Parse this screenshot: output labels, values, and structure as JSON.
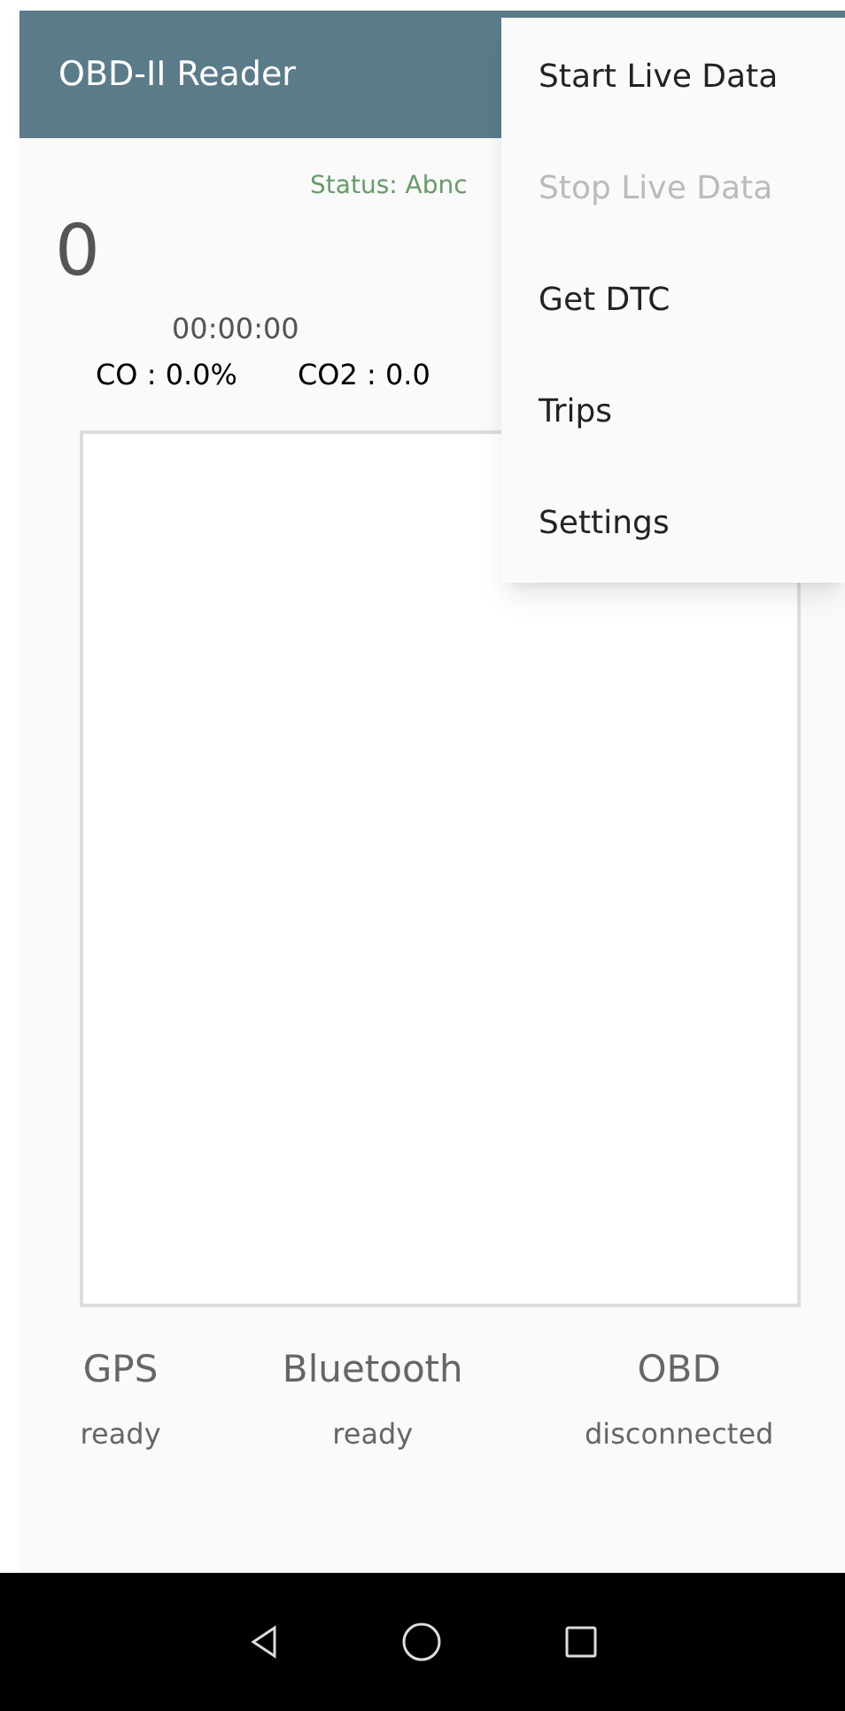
{
  "app_bar": {
    "title": "OBD-II Reader"
  },
  "status": "Status: Abnc",
  "speed": "0",
  "timer": "00:00:00",
  "readings": [
    "CO : 0.0%",
    "CO2 : 0.0"
  ],
  "indicators": [
    {
      "name": "GPS",
      "state": "ready"
    },
    {
      "name": "Bluetooth",
      "state": "ready"
    },
    {
      "name": "OBD",
      "state": "disconnected"
    }
  ],
  "menu": [
    {
      "label": "Start Live Data",
      "disabled": false
    },
    {
      "label": "Stop Live Data",
      "disabled": true
    },
    {
      "label": "Get DTC",
      "disabled": false
    },
    {
      "label": "Trips",
      "disabled": false
    },
    {
      "label": "Settings",
      "disabled": false
    }
  ]
}
